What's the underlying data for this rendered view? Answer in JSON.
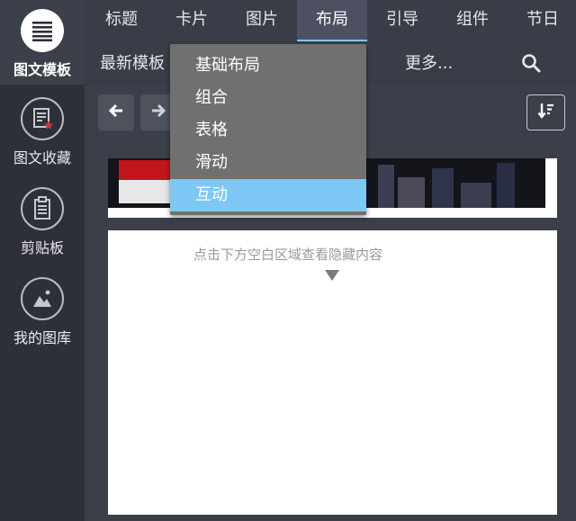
{
  "sidebar": {
    "items": [
      {
        "label": "图文模板",
        "icon": "text-lines-icon"
      },
      {
        "label": "图文收藏",
        "icon": "favorite-doc-icon"
      },
      {
        "label": "剪贴板",
        "icon": "clipboard-icon"
      },
      {
        "label": "我的图库",
        "icon": "gallery-icon"
      }
    ]
  },
  "tabs": [
    {
      "label": "标题"
    },
    {
      "label": "卡片"
    },
    {
      "label": "图片"
    },
    {
      "label": "布局"
    },
    {
      "label": "引导"
    },
    {
      "label": "组件"
    },
    {
      "label": "节日"
    }
  ],
  "subrow": {
    "latest_label": "最新模板",
    "more_label": "更多..."
  },
  "dropdown": {
    "items": [
      {
        "label": "基础布局"
      },
      {
        "label": "组合"
      },
      {
        "label": "表格"
      },
      {
        "label": "滑动"
      },
      {
        "label": "互动"
      }
    ]
  },
  "hidden_area": {
    "hint": "点击下方空白区域查看隐藏内容"
  },
  "colors": {
    "accent": "#7ec8f5",
    "sidebar_bg": "#2e3038",
    "panel_bg": "#3b3f49",
    "dropdown_bg": "#707070"
  }
}
